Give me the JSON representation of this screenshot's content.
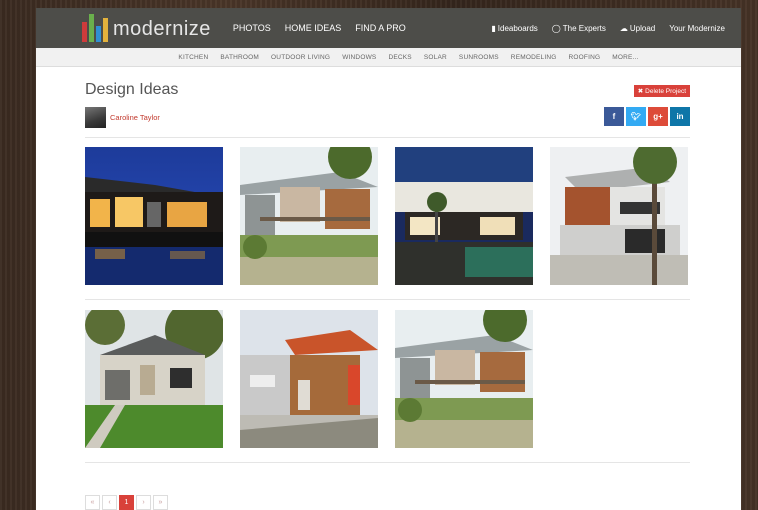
{
  "brand": {
    "name": "modernize"
  },
  "main_nav": [
    {
      "label": "PHOTOS"
    },
    {
      "label": "HOME IDEAS"
    },
    {
      "label": "FIND A PRO"
    }
  ],
  "right_nav": [
    {
      "label": "Ideaboards",
      "icon": "book-icon",
      "glyph": "▮"
    },
    {
      "label": "The Experts",
      "icon": "chat-bubble-icon",
      "glyph": "◯"
    },
    {
      "label": "Upload",
      "icon": "cloud-upload-icon",
      "glyph": "☁"
    },
    {
      "label": "Your Modernize",
      "icon": "",
      "glyph": ""
    }
  ],
  "sub_nav": [
    "KITCHEN",
    "BATHROOM",
    "OUTDOOR LIVING",
    "WINDOWS",
    "DECKS",
    "SOLAR",
    "SUNROOMS",
    "REMODELING",
    "ROOFING",
    "MORE..."
  ],
  "page": {
    "title": "Design Ideas",
    "delete_label": "Delete Project",
    "author": "Caroline Taylor"
  },
  "social": [
    {
      "label": "f",
      "name": "facebook"
    },
    {
      "label": "t",
      "name": "twitter"
    },
    {
      "label": "g+",
      "name": "google-plus"
    },
    {
      "label": "in",
      "name": "linkedin"
    }
  ],
  "photos": [
    {
      "id": "modern-home-night-pool"
    },
    {
      "id": "modern-home-deck-garden"
    },
    {
      "id": "modern-home-courtyard-pool"
    },
    {
      "id": "modern-home-wood-cantilever"
    },
    {
      "id": "modern-home-stone-lawn"
    },
    {
      "id": "modern-home-wood-facade"
    },
    {
      "id": "modern-home-deck-garden-2"
    }
  ],
  "pagination": [
    "«",
    "‹",
    "1",
    "›",
    "»"
  ],
  "pagination_active": "1",
  "colors": {
    "accent_red": "#d9413a",
    "topbar": "#4d4d49",
    "facebook": "#3b5998",
    "twitter": "#33aaf3",
    "google_plus": "#dd4b39",
    "linkedin": "#0e76a8"
  }
}
